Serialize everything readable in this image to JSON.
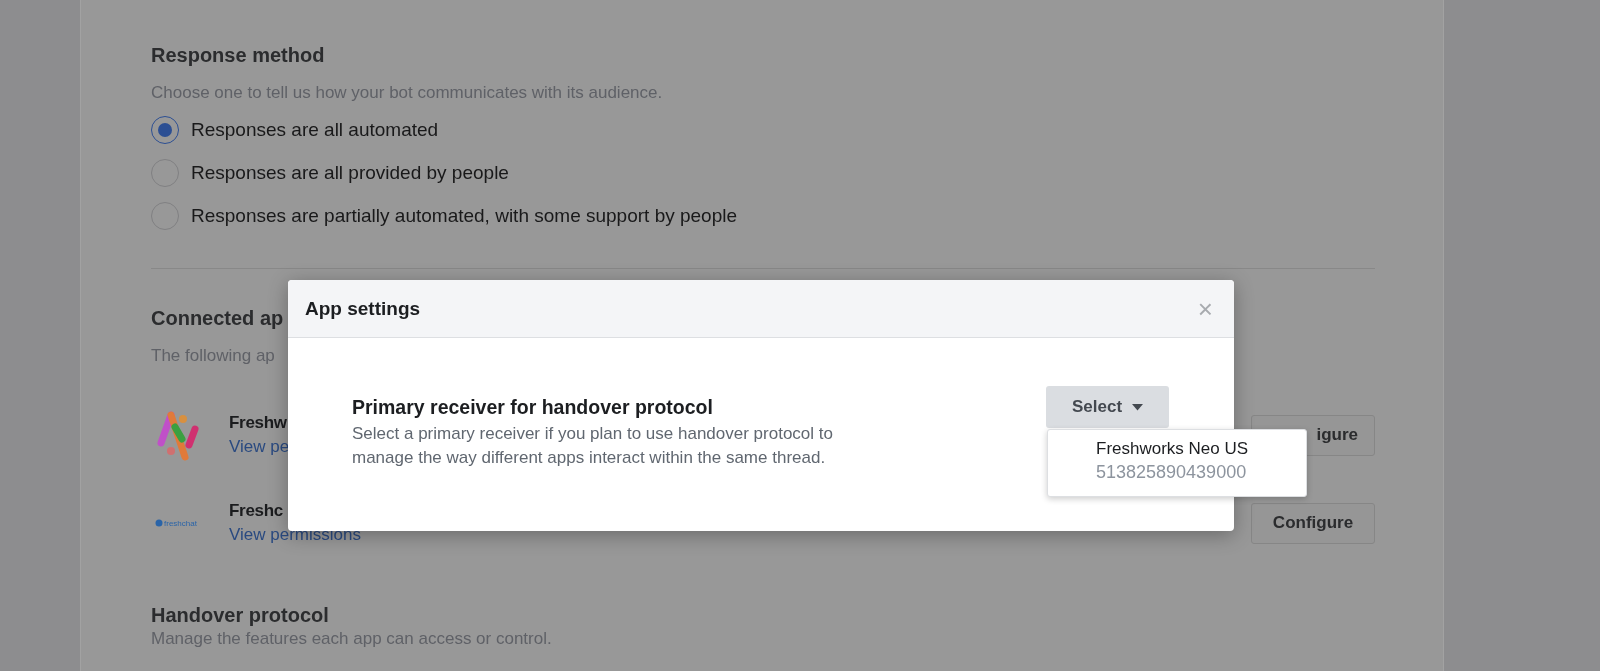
{
  "response_method": {
    "title": "Response method",
    "description": "Choose one to tell us how your bot communicates with its audience.",
    "options": [
      {
        "label": "Responses are all automated",
        "selected": true
      },
      {
        "label": "Responses are all provided by people",
        "selected": false
      },
      {
        "label": "Responses are partially automated, with some support by people",
        "selected": false
      }
    ]
  },
  "connected_apps": {
    "title": "Connected ap",
    "description": "The following ap",
    "apps": [
      {
        "kind": "neo",
        "name": "Freshw",
        "link": "View pe",
        "button": "igure"
      },
      {
        "kind": "chat",
        "logo_text": "freshchat",
        "name": "Freshc",
        "link": "View permissions",
        "button": "Configure"
      }
    ]
  },
  "handover": {
    "title": "Handover protocol",
    "description": "Manage the features each app can access or control."
  },
  "dialog": {
    "title": "App settings",
    "close": "×",
    "field_title": "Primary receiver for handover protocol",
    "field_description": "Select a primary receiver if you plan to use handover protocol to manage the way different apps interact within the same thread.",
    "select": {
      "label": "Select",
      "expanded": true,
      "options": [
        {
          "name": "Freshworks Neo US",
          "id": "513825890439000"
        }
      ]
    }
  }
}
